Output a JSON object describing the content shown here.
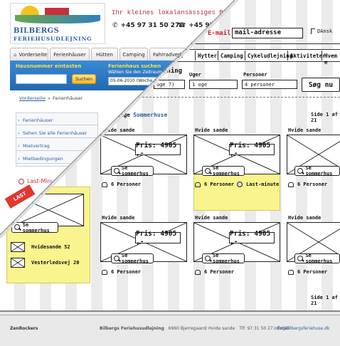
{
  "wire": {
    "email_prefix": "E-mail",
    "email_label": "mail-adresse",
    "lang_label": "DAnsk",
    "nav": [
      "use",
      "Hytter",
      "Camping",
      "Cykeludlejning",
      "Aktiviteter",
      "Hvem e"
    ],
    "search": {
      "title_tail": "gning",
      "weeks_label": "Uger",
      "persons_label": "Personer",
      "date_value": "uge 7)",
      "weeks_value": "1 uge",
      "persons_value": "4 personer",
      "button": "Søg nu"
    },
    "heading_a": "ædige",
    "heading_b": "Sommerhuse",
    "page_info_top": "Side 1 af 21",
    "page_info_bottom": "Side 1 af 21",
    "card_name": "Hvide sande",
    "price": "Pris: 4905 ,-",
    "see_house": "Se sommerhus",
    "persons": "6 Personer",
    "last_minute": "Last-minute",
    "sidebar_see_house": "Se sommerhus",
    "sidebar_houses": [
      {
        "name": "Hvidesande",
        "num": "52"
      },
      {
        "name": "Vesterledsvej 20",
        "num": ""
      }
    ]
  },
  "site": {
    "logo_line1": "BILBERGS",
    "logo_line2": "FERIEHUSUDLEJNING",
    "tagline": "Ihr kleines lokalansässiges Buch",
    "phone1": "+45 97 31 50 27",
    "phone2": "+45 97",
    "tabs": [
      "Vorderseite",
      "Ferienhäuser",
      "Hütten",
      "Camping",
      "Fahrradverle"
    ],
    "house_number_title": "Hausnummer eintasten",
    "search_button": "Suchen",
    "ferienhaus_title": "Ferienhaus suchen",
    "zeitraum_label": "Wählen Sie den Zeitraum",
    "date_value": "05-06-2010 (Woche",
    "breadcrumb_home": "Vorderseite",
    "breadcrumb_current": "Ferienhäuser",
    "sidebar": [
      "Ferienhäuser",
      "Sehen Sie alle Ferienhäuser",
      "Mietvertrag",
      "Mietbedingungen"
    ],
    "last_minute_title": "Last-Minu",
    "last_badge": "LAST"
  },
  "footer": {
    "left": "ZenRockers",
    "company": "Bilbergs Feriehusudlejning",
    "address": "6960 Bjerregaard/ Hvide sande",
    "phone": "Tlf: 97 31 50 27",
    "email_label": "Email:",
    "email": "info@bilbergsferiehuse.dk"
  },
  "colors": {
    "site_blue": "#2a78c6",
    "wire_yellow": "#f9f48d",
    "accent_blue": "#2b5fa0"
  }
}
